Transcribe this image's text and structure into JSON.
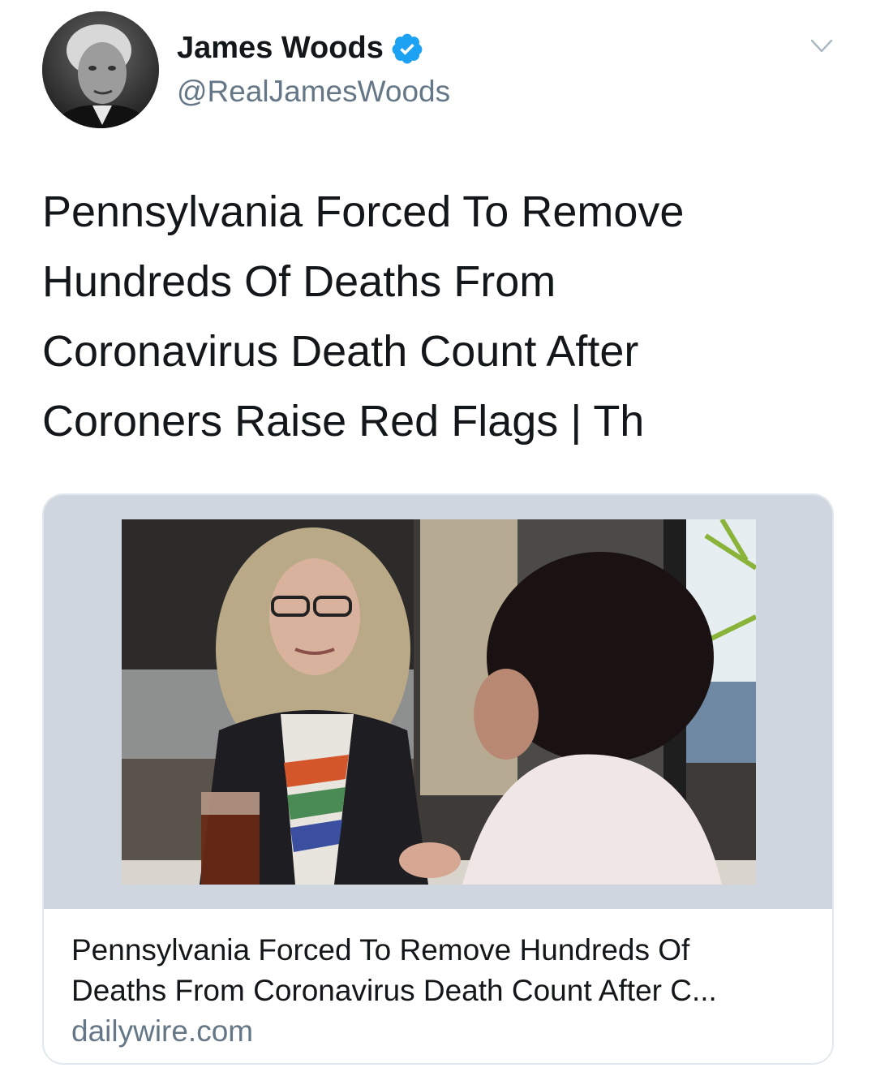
{
  "tweet": {
    "author": {
      "display_name": "James Woods",
      "handle": "@RealJamesWoods",
      "verified": true,
      "avatar_icon": "portrait-photo"
    },
    "menu_icon": "chevron-down-icon",
    "text_lines": [
      "Pennsylvania Forced To Remove",
      "Hundreds Of Deaths From",
      "Coronavirus Death Count After",
      "Coroners Raise Red Flags | Th"
    ],
    "card": {
      "image": "photo",
      "title_lines": [
        "Pennsylvania Forced To Remove Hundreds Of",
        "Deaths From Coronavirus Death Count After C..."
      ],
      "domain": "dailywire.com"
    }
  },
  "colors": {
    "text": "#14171a",
    "secondary_text": "#657786",
    "verified_blue": "#1da1f2",
    "card_border": "#e1e8ed",
    "card_media_background": "#cfd6df"
  }
}
